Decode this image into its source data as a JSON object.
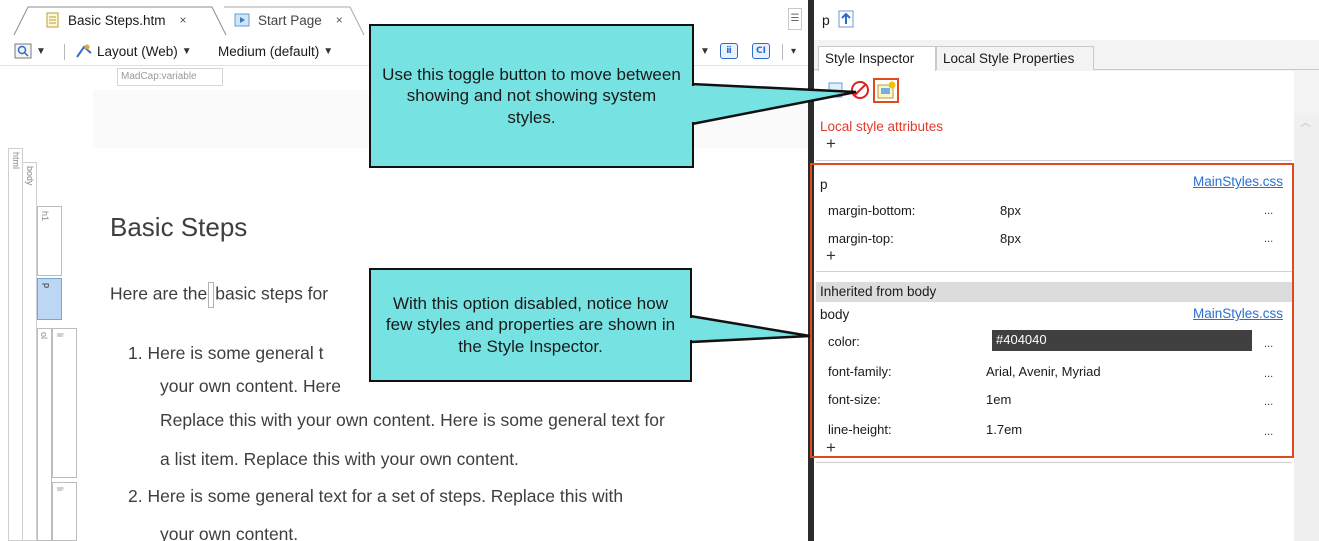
{
  "editor": {
    "tabs": [
      {
        "label": "Basic Steps.htm",
        "close": "×",
        "icon": "document-icon"
      },
      {
        "label": "Start Page",
        "close": "×",
        "icon": "start-page-icon"
      }
    ],
    "toolbar": {
      "layout_label": "Layout (Web)",
      "medium_label": "Medium (default)",
      "view_icon": "zoom-icon",
      "layout_icon": "layout-icon",
      "btn_variable_abbr": "ⅱ",
      "btn_condition_abbr": "CI"
    },
    "variable_tag": "MadCap:variable",
    "structure_labels": {
      "html": "html",
      "body": "body",
      "h1": "h1",
      "p": "p",
      "ol": "ol",
      "li1": "li",
      "li2": "li"
    },
    "document": {
      "heading": "Basic Steps",
      "para_before_cursor": "Here are the",
      "para_after_cursor": "basic steps for",
      "list_lines": [
        "1.  Here is some general t",
        "your own content. Here",
        "Replace this with your own content. Here is some general text for",
        "a list item. Replace this with your own content.",
        "2.  Here is some general text for a set of steps. Replace this with",
        "your own content."
      ]
    }
  },
  "inspector": {
    "element_label": "p",
    "tabs": [
      "Style Inspector",
      "Local Style Properties"
    ],
    "local_title": "Local style attributes",
    "plus": "+",
    "p_rule": {
      "selector": "p",
      "source": "MainStyles.css",
      "props": [
        {
          "name": "margin-bottom:",
          "value": "8px",
          "dots": "..."
        },
        {
          "name": "margin-top:",
          "value": "8px",
          "dots": "..."
        }
      ]
    },
    "inherited_label": "Inherited from body",
    "body_rule": {
      "selector": "body",
      "source": "MainStyles.css",
      "props": [
        {
          "name": "color:",
          "value": "#404040",
          "dots": "..."
        },
        {
          "name": "font-family:",
          "value": "Arial, Avenir, Myriad",
          "dots": "..."
        },
        {
          "name": "font-size:",
          "value": "1em",
          "dots": "..."
        },
        {
          "name": "line-height:",
          "value": "1.7em",
          "dots": "..."
        }
      ]
    }
  },
  "callouts": {
    "top": "Use this toggle button to move between showing and not showing system styles.",
    "bottom": "With this option disabled, notice how few styles and properties are shown in the Style Inspector."
  },
  "colors": {
    "callout_fill": "#77e2e2",
    "highlight": "#e04a1f",
    "link": "#2b6fd1",
    "local_title": "#e23b2b",
    "color_swatch": "#404040"
  }
}
